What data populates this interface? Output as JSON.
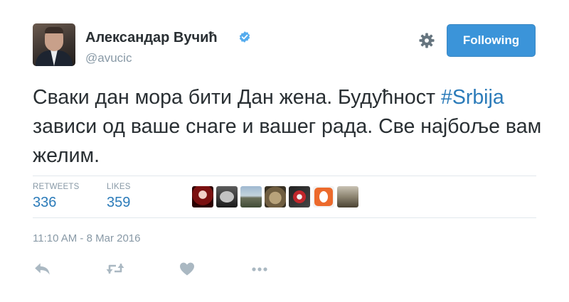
{
  "author": {
    "name": "Александар Вучић",
    "handle": "@avucic",
    "verified": true
  },
  "follow_button": {
    "label": "Following"
  },
  "tweet": {
    "text_parts": [
      "Сваки дан мора бити Дан жена. Будућност ",
      "#Srbija",
      " зависи од ваше снаге и вашег рада. Све најбоље вам желим."
    ]
  },
  "stats": {
    "retweets_label": "RETWEETS",
    "retweets_count": "336",
    "likes_label": "LIKES",
    "likes_count": "359"
  },
  "liker_avatars": [
    "avatar-1",
    "avatar-2",
    "avatar-3",
    "avatar-4",
    "avatar-5",
    "avatar-6",
    "avatar-7"
  ],
  "timestamp": "11:10 AM - 8 Mar 2016",
  "actions": [
    "reply-icon",
    "retweet-icon",
    "like-icon",
    "more-icon"
  ],
  "colors": {
    "accent": "#2b7bb9",
    "button": "#3b94d9",
    "muted": "#8899a6",
    "icon": "#aab8c2",
    "text": "#292f33"
  }
}
